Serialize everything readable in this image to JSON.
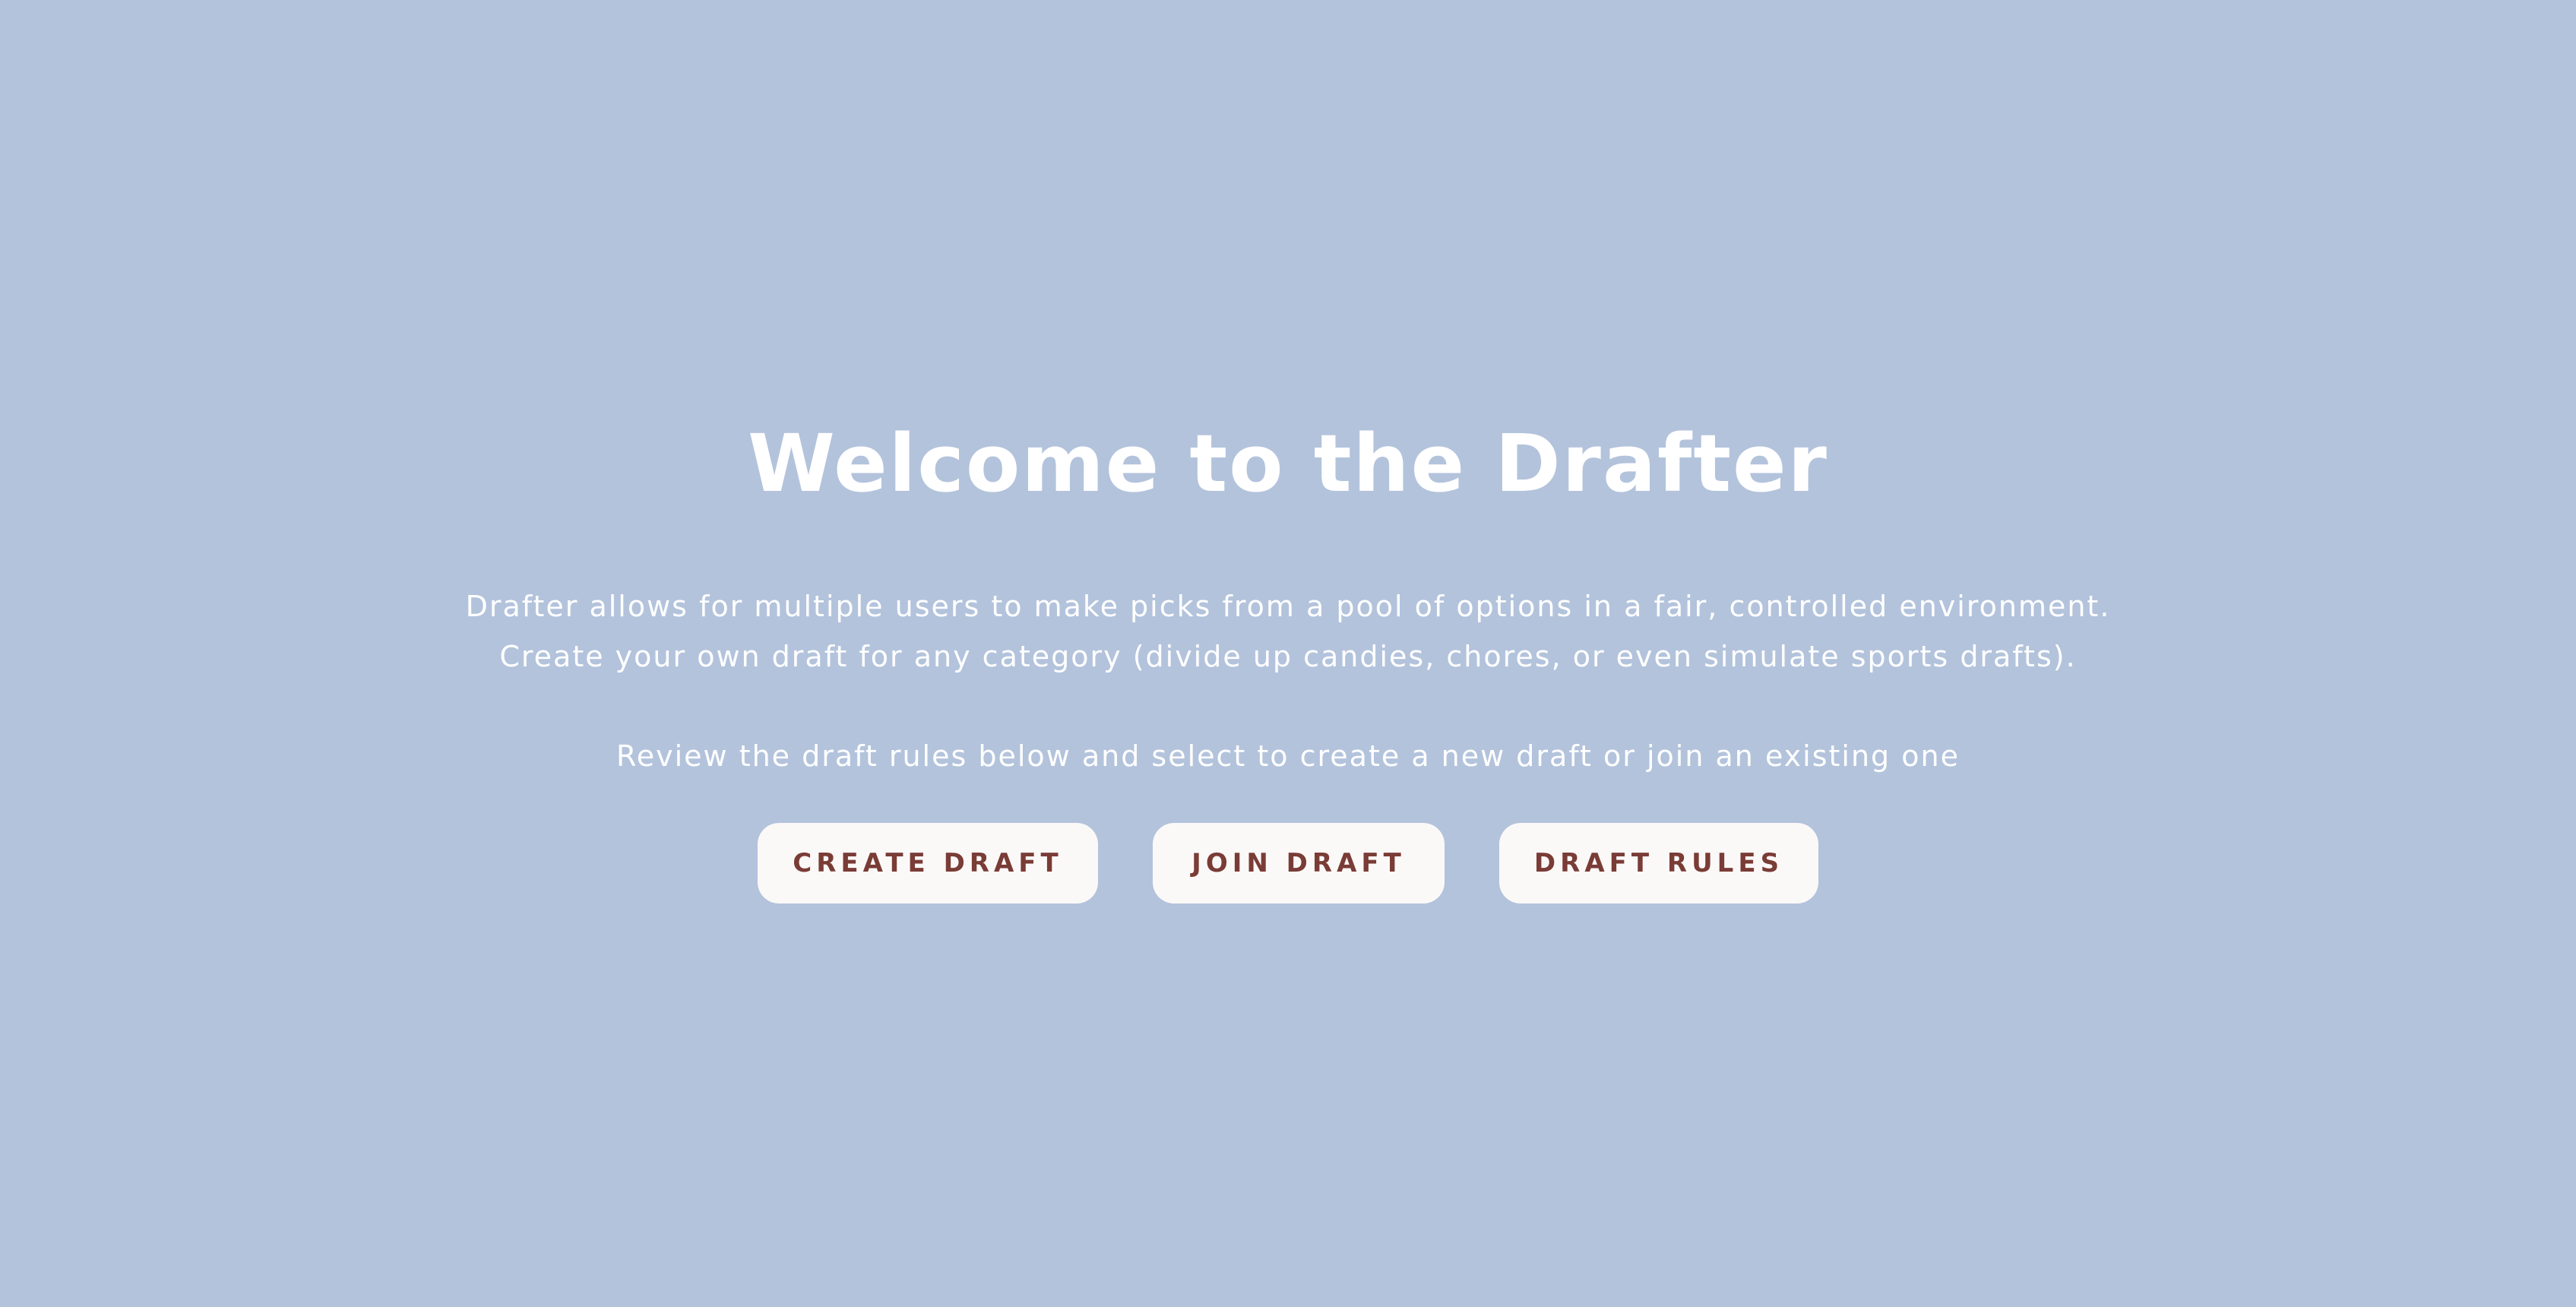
{
  "hero": {
    "title": "Welcome to the Drafter",
    "description_lines": [
      "Drafter allows for multiple users to make picks from a pool of options in a fair, controlled environment.",
      "Create your own draft for any category (divide up candies, chores, or even simulate sports drafts)."
    ],
    "instruction": "Review the draft rules below and select to create a new draft or join an existing one"
  },
  "actions": {
    "create_label": "CREATE DRAFT",
    "join_label": "JOIN DRAFT",
    "rules_label": "DRAFT RULES"
  },
  "colors": {
    "background": "#b3c3dc",
    "text": "#ffffff",
    "button_bg": "#fbf9f8",
    "button_text": "#7a3c36"
  }
}
